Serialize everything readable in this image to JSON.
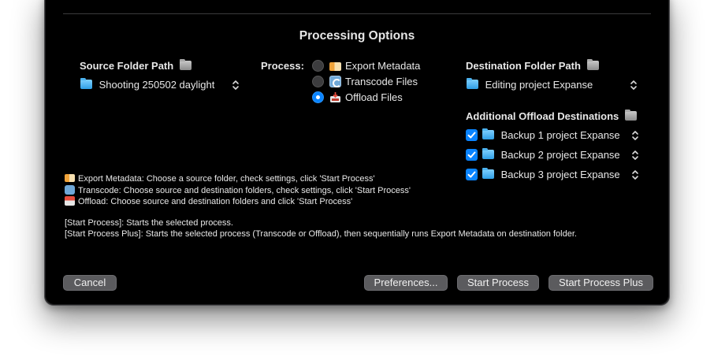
{
  "dialog": {
    "title": "Processing Options"
  },
  "source": {
    "label": "Source Folder Path",
    "selected": "Shooting 250502 daylight"
  },
  "process": {
    "label": "Process:",
    "options": [
      {
        "label": "Export Metadata",
        "selected": false,
        "icon": "tag-icon"
      },
      {
        "label": "Transcode Files",
        "selected": false,
        "icon": "arrows-cycle-icon"
      },
      {
        "label": "Offload Files",
        "selected": true,
        "icon": "inbox-tray-icon"
      }
    ]
  },
  "destination": {
    "label": "Destination Folder Path",
    "selected": "Editing project Expanse"
  },
  "additional": {
    "label": "Additional Offload Destinations",
    "items": [
      {
        "label": "Backup 1 project Expanse",
        "checked": true
      },
      {
        "label": "Backup 2 project Expanse",
        "checked": true
      },
      {
        "label": "Backup 3 project Expanse",
        "checked": true
      }
    ]
  },
  "help": {
    "export": "Export Metadata: Choose a source folder, check settings, click 'Start Process'",
    "transcode": "Transcode: Choose source and destination folders, check settings, click 'Start Process'",
    "offload": "Offload: Choose source and destination folders and click 'Start Process'",
    "start_process": "[Start Process]: Starts the selected process.",
    "start_process_plus": "[Start Process Plus]: Starts the selected process (Transcode or Offload), then sequentially runs Export Metadata on destination folder."
  },
  "buttons": {
    "cancel": "Cancel",
    "preferences": "Preferences...",
    "start": "Start Process",
    "start_plus": "Start Process Plus"
  },
  "colors": {
    "accent": "#0a84ff",
    "background": "#000000",
    "button": "#5b5b5e"
  }
}
